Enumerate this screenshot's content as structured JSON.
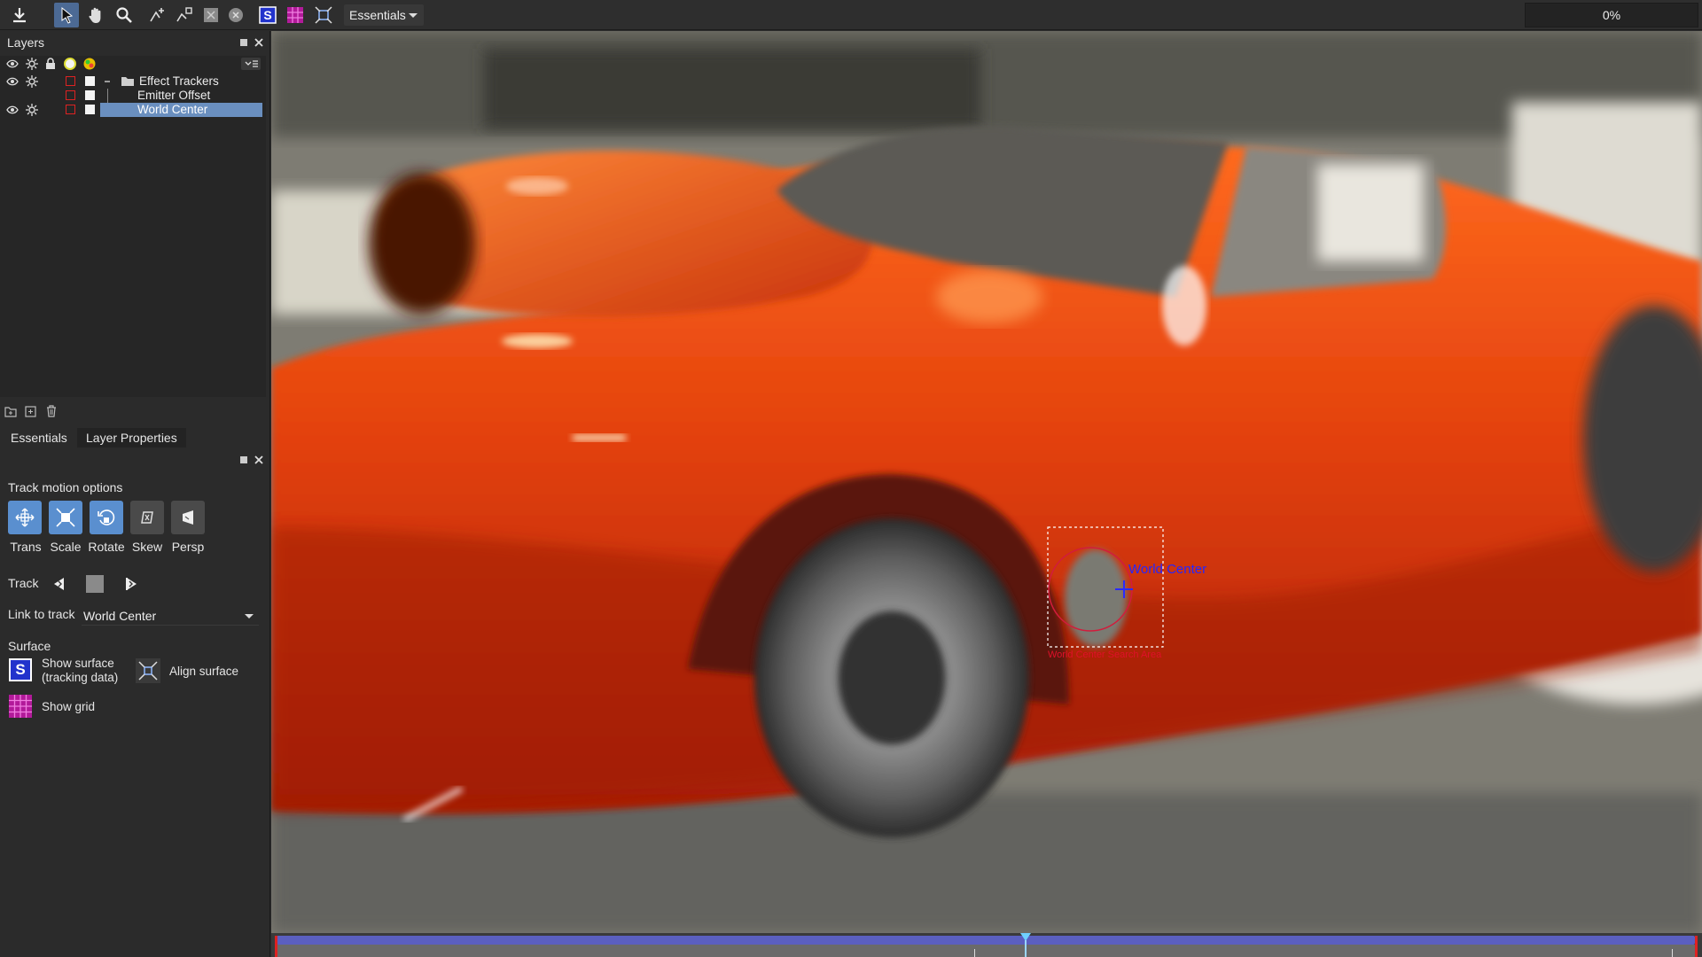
{
  "toolbar": {
    "workspace": "Essentials",
    "progress": "0%",
    "icons": [
      "download-icon",
      "select-arrow-icon",
      "hand-icon",
      "magnify-icon",
      "add-point-icon",
      "move-point-icon",
      "clear-square-icon",
      "clear-circle-icon",
      "surface-s-icon",
      "grid-icon",
      "align-surface-icon"
    ]
  },
  "layers_panel": {
    "title": "Layers",
    "layers": [
      {
        "name": "Effect Trackers",
        "type": "folder"
      },
      {
        "name": "Emitter Offset",
        "type": "child"
      },
      {
        "name": "World Center",
        "type": "child",
        "selected": true
      }
    ]
  },
  "tabs": [
    {
      "label": "Essentials",
      "active": false
    },
    {
      "label": "Layer Properties",
      "active": true
    }
  ],
  "properties": {
    "track_motion_label": "Track motion options",
    "modes": [
      {
        "label": "Trans",
        "on": true
      },
      {
        "label": "Scale",
        "on": true
      },
      {
        "label": "Rotate",
        "on": true
      },
      {
        "label": "Skew",
        "on": false
      },
      {
        "label": "Persp",
        "on": false
      }
    ],
    "track_label": "Track",
    "link_label": "Link to track",
    "link_value": "World Center",
    "surface_label": "Surface",
    "show_surface_line1": "Show surface",
    "show_surface_line2": "(tracking data)",
    "align_surface": "Align surface",
    "show_grid": "Show grid"
  },
  "viewer": {
    "tracker_name": "World Center",
    "search_area_label": "World Center Search Area"
  },
  "colors": {
    "accent": "#5a8fcf",
    "selection": "#6a8fbf",
    "car": "#e2400c",
    "timeline": "#5b5fc0"
  }
}
